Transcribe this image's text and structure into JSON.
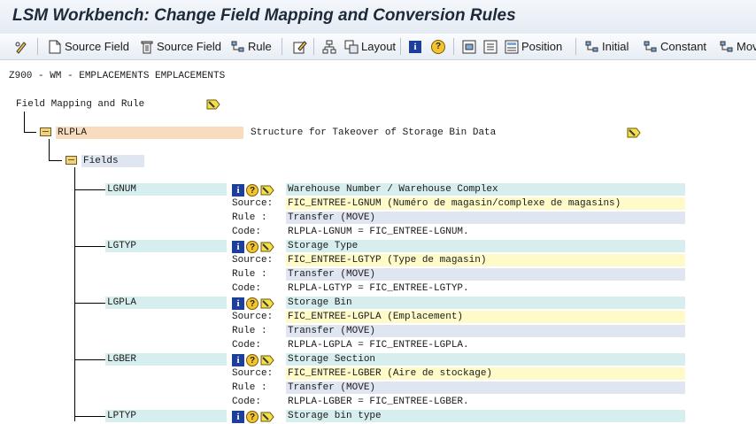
{
  "window": {
    "title": "LSM Workbench: Change Field Mapping and Conversion Rules"
  },
  "toolbar": {
    "source_field_create": "Source Field",
    "source_field_delete": "Source Field",
    "rule": "Rule",
    "layout": "Layout",
    "position": "Position",
    "initial": "Initial",
    "constant": "Constant",
    "move": "Mov"
  },
  "header": {
    "object_line": "Z900 - WM - EMPLACEMENTS EMPLACEMENTS"
  },
  "tree": {
    "root_label": "Field Mapping and Rule",
    "structure": {
      "name": "RLPLA",
      "description": "Structure for Takeover of Storage Bin Data"
    },
    "fields_label": "Fields",
    "labels": {
      "source": "Source:",
      "rule": "Rule  :",
      "code": "Code:"
    },
    "fields": [
      {
        "name": "LGNUM",
        "description": "Warehouse Number / Warehouse Complex",
        "source": "FIC_ENTREE-LGNUM (Numéro de magasin/complexe de magasins)",
        "rule": "Transfer (MOVE)",
        "code": "RLPLA-LGNUM = FIC_ENTREE-LGNUM."
      },
      {
        "name": "LGTYP",
        "description": "Storage Type",
        "source": "FIC_ENTREE-LGTYP (Type de magasin)",
        "rule": "Transfer (MOVE)",
        "code": "RLPLA-LGTYP = FIC_ENTREE-LGTYP."
      },
      {
        "name": "LGPLA",
        "description": "Storage Bin",
        "source": "FIC_ENTREE-LGPLA (Emplacement)",
        "rule": "Transfer (MOVE)",
        "code": "RLPLA-LGPLA = FIC_ENTREE-LGPLA."
      },
      {
        "name": "LGBER",
        "description": "Storage Section",
        "source": "FIC_ENTREE-LGBER (Aire de stockage)",
        "rule": "Transfer (MOVE)",
        "code": "RLPLA-LGBER = FIC_ENTREE-LGBER."
      },
      {
        "name": "LPTYP",
        "description": "Storage bin type"
      }
    ]
  },
  "colors": {
    "field_name_bg": "#d6eeee",
    "source_bg": "#fffbc8",
    "rule_bg": "#dfe6f2",
    "structure_bg": "#f8dcbd"
  }
}
